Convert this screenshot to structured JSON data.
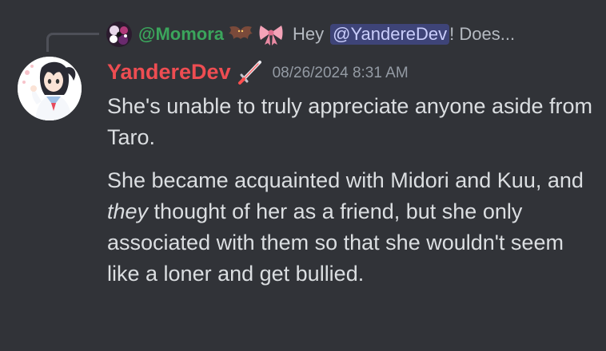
{
  "reply": {
    "author": "@Momora",
    "emoji_1": "bat-emoji",
    "emoji_2": "ribbon-emoji",
    "text_before": "Hey",
    "mention": "@YandereDev",
    "text_after": "! Does..."
  },
  "message": {
    "author": "YandereDev",
    "role_icon": "sword-icon",
    "timestamp": "08/26/2024 8:31 AM",
    "paragraph_1": "She's unable to truly appreciate anyone aside from Taro.",
    "paragraph_2_part_1": "She became acquainted with Midori and Kuu, and ",
    "paragraph_2_emphasis": "they",
    "paragraph_2_part_2": " thought of her as a friend, but she only associated with them so that she wouldn't seem like a loner and get bullied."
  },
  "colors": {
    "background": "#313338",
    "reply_author": "#3ba55c",
    "message_author": "#ee4d52",
    "mention_bg": "#5865f2",
    "body_text": "#dbdee1",
    "muted_text": "#949ba4"
  }
}
